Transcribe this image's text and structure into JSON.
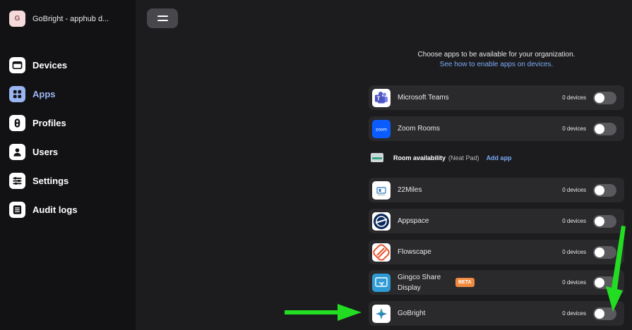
{
  "org": {
    "initial": "G",
    "name": "GoBright - apphub d..."
  },
  "nav": [
    {
      "label": "Devices",
      "icon": "devices-icon"
    },
    {
      "label": "Apps",
      "icon": "apps-icon",
      "active": true
    },
    {
      "label": "Profiles",
      "icon": "profiles-icon"
    },
    {
      "label": "Users",
      "icon": "users-icon"
    },
    {
      "label": "Settings",
      "icon": "settings-icon"
    },
    {
      "label": "Audit logs",
      "icon": "audit-logs-icon"
    }
  ],
  "intro": {
    "text": "Choose apps to be available for your organization.",
    "link": "See how to enable apps on devices."
  },
  "apps_top": [
    {
      "name": "Microsoft Teams",
      "count": "0 devices",
      "enabled": false,
      "icon": "microsoft-teams-icon"
    },
    {
      "name": "Zoom Rooms",
      "count": "0 devices",
      "enabled": false,
      "icon": "zoom-icon",
      "logo_text": "zoom"
    }
  ],
  "section": {
    "title": "Room availability",
    "subtitle": "(Neat Pad)",
    "add": "Add app"
  },
  "apps_room": [
    {
      "name": "22Miles",
      "count": "0 devices",
      "enabled": false,
      "icon": "22miles-icon"
    },
    {
      "name": "Appspace",
      "count": "0 devices",
      "enabled": false,
      "icon": "appspace-icon"
    },
    {
      "name": "Flowscape",
      "count": "0 devices",
      "enabled": false,
      "icon": "flowscape-icon"
    },
    {
      "name": "Gingco Share Display",
      "count": "0 devices",
      "enabled": false,
      "icon": "gingco-icon",
      "badge": "BETA"
    },
    {
      "name": "GoBright",
      "count": "0 devices",
      "enabled": false,
      "icon": "gobright-icon"
    }
  ],
  "colors": {
    "accent": "#9ab5f2",
    "link": "#7aa8f5",
    "beta": "#f08a3e",
    "arrow": "#22dd22"
  }
}
